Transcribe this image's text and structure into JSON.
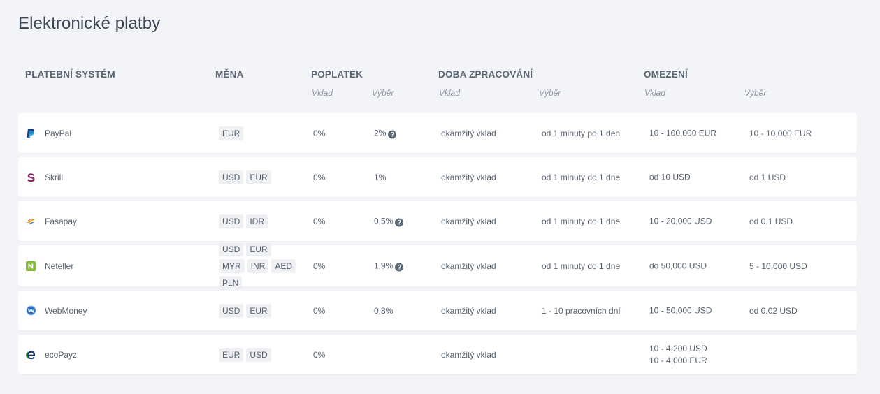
{
  "title": "Elektronické platby",
  "headers": {
    "system": "PLATEBNÍ SYSTÉM",
    "currency": "MĚNA",
    "fee": "POPLATEK",
    "processing": "DOBA ZPRACOVÁNÍ",
    "limits": "OMEZENÍ",
    "deposit": "Vklad",
    "withdrawal": "Výběr"
  },
  "rows": [
    {
      "name": "PayPal",
      "icon": "paypal-icon",
      "currencies": [
        "EUR"
      ],
      "fee_deposit": "0%",
      "fee_withdrawal": "2%",
      "fee_withdrawal_help": true,
      "proc_deposit": "okamžitý vklad",
      "proc_withdrawal": "od 1 minuty po 1 den",
      "limit_deposit": [
        "10 - 100,000 EUR"
      ],
      "limit_withdrawal": "10 - 10,000 EUR"
    },
    {
      "name": "Skrill",
      "icon": "skrill-icon",
      "currencies": [
        "USD",
        "EUR"
      ],
      "fee_deposit": "0%",
      "fee_withdrawal": "1%",
      "fee_withdrawal_help": false,
      "proc_deposit": "okamžitý vklad",
      "proc_withdrawal": "od 1 minuty do 1 dne",
      "limit_deposit": [
        "od 10 USD"
      ],
      "limit_withdrawal": "od 1 USD"
    },
    {
      "name": "Fasapay",
      "icon": "fasapay-icon",
      "currencies": [
        "USD",
        "IDR"
      ],
      "fee_deposit": "0%",
      "fee_withdrawal": "0,5%",
      "fee_withdrawal_help": true,
      "proc_deposit": "okamžitý vklad",
      "proc_withdrawal": "od 1 minuty do 1 dne",
      "limit_deposit": [
        "10 - 20,000 USD"
      ],
      "limit_withdrawal": "od 0.1 USD"
    },
    {
      "name": "Neteller",
      "icon": "neteller-icon",
      "currencies": [
        "USD",
        "EUR",
        "MYR",
        "INR",
        "AED",
        "PLN"
      ],
      "fee_deposit": "0%",
      "fee_withdrawal": "1,9%",
      "fee_withdrawal_help": true,
      "proc_deposit": "okamžitý vklad",
      "proc_withdrawal": "od 1 minuty do 1 dne",
      "limit_deposit": [
        "do 50,000 USD"
      ],
      "limit_withdrawal": "5 - 10,000 USD"
    },
    {
      "name": "WebMoney",
      "icon": "webmoney-icon",
      "currencies": [
        "USD",
        "EUR"
      ],
      "fee_deposit": "0%",
      "fee_withdrawal": "0,8%",
      "fee_withdrawal_help": false,
      "proc_deposit": "okamžitý vklad",
      "proc_withdrawal": "1 - 10 pracovních dní",
      "limit_deposit": [
        "10 - 50,000 USD"
      ],
      "limit_withdrawal": "od 0.02 USD"
    },
    {
      "name": "ecoPayz",
      "icon": "ecopayz-icon",
      "currencies": [
        "EUR",
        "USD"
      ],
      "fee_deposit": "0%",
      "fee_withdrawal": "",
      "fee_withdrawal_help": false,
      "proc_deposit": "okamžitý vklad",
      "proc_withdrawal": "",
      "limit_deposit": [
        "10 - 4,200 USD",
        "10 - 4,000 EUR"
      ],
      "limit_withdrawal": ""
    }
  ],
  "help_glyph": "?",
  "colors": {
    "paypal": "#253b80",
    "skrill": "#862165",
    "neteller": "#83ba3b",
    "webmoney": "#2f6fbf",
    "ecopayz": "#3a9d3a"
  }
}
